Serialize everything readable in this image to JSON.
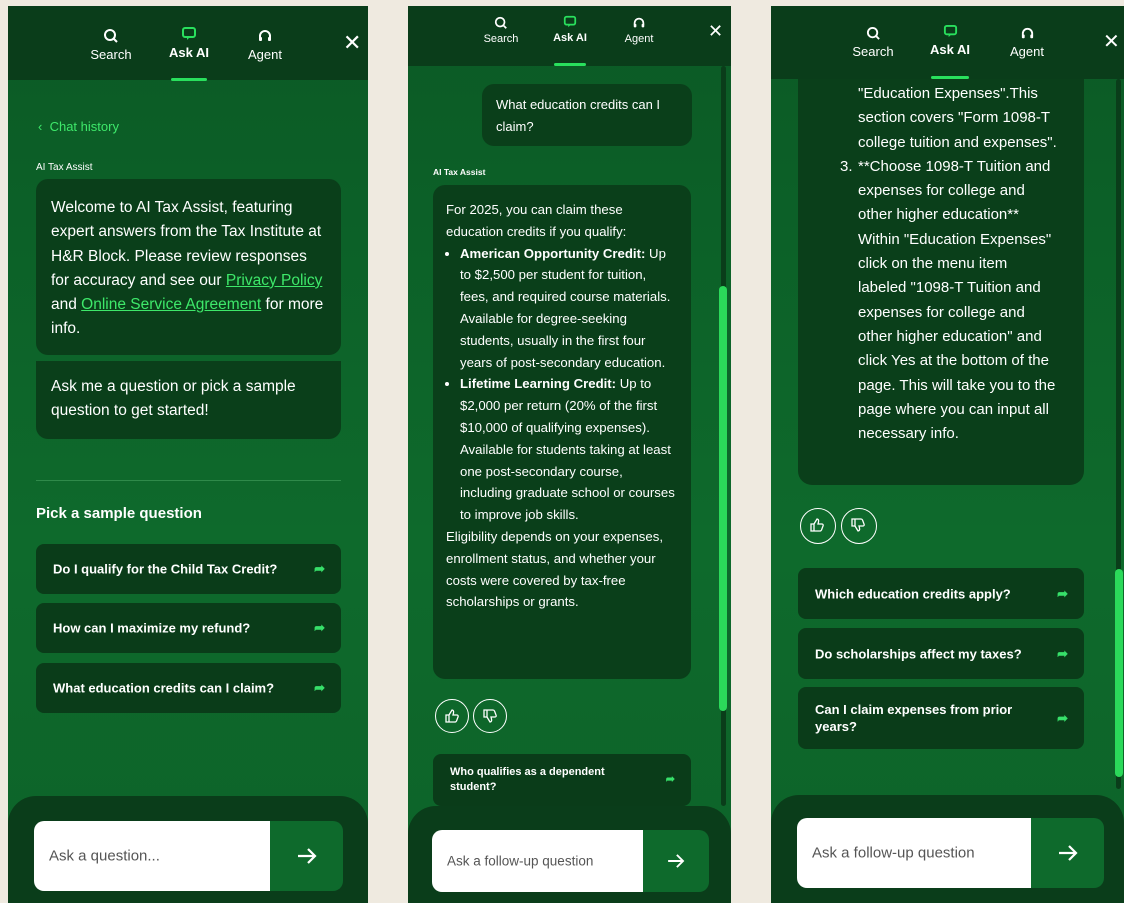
{
  "tabs": {
    "search": "Search",
    "ask_ai": "Ask AI",
    "agent": "Agent"
  },
  "panel1": {
    "chat_history": "Chat history",
    "assistant_label": "AI Tax Assist",
    "welcome_pre": "Welcome to AI Tax Assist, featuring expert answers from the Tax Institute at H&R Block. Please review responses for accuracy and see our ",
    "privacy_link": "Privacy Policy",
    "and": " and ",
    "online_link": "Online Service Agreement",
    "welcome_post": " for more info.",
    "prompt_msg": "Ask me a question or pick a sample question to get started!",
    "sample_heading": "Pick a sample question",
    "samples": [
      "Do I qualify for the Child Tax Credit?",
      "How can I maximize my refund?",
      "What education credits can I claim?"
    ],
    "input_placeholder": "Ask a question..."
  },
  "panel2": {
    "user_msg": "What education credits can I claim?",
    "assistant_label": "AI Tax Assist",
    "intro": "For 2025, you can claim these education credits if you qualify:",
    "credits": [
      {
        "name": "American Opportunity Credit:",
        "desc": "Up to $2,500 per student for tuition, fees, and required course materials. Available for degree-seeking students, usually in the first four years of post-secondary education."
      },
      {
        "name": "Lifetime Learning Credit:",
        "desc": "Up to $2,000 per return (20% of the first $10,000 of qualifying expenses). Available for students taking at least one post-secondary course, including graduate school or courses to improve job skills."
      }
    ],
    "eligibility": "Eligibility depends on your expenses, enrollment status, and whether your costs were covered by tax-free scholarships or grants.",
    "followup": "Who qualifies as a dependent student?",
    "input_placeholder": "Ask a follow-up question",
    "scroll_fraction": 0.5
  },
  "panel3": {
    "answer_lines": [
      "\"Education Expenses\".This",
      "section covers \"Form 1098-T",
      "college tuition and expenses\".",
      "**Choose 1098-T Tuition and",
      "expenses for college and",
      "other higher education**",
      "Within \"Education Expenses\"",
      "click on the menu item",
      "labeled \"1098-T Tuition and",
      "expenses for college and",
      "other higher education\" and",
      "click Yes at the bottom of the",
      "page. This will take you to the",
      "page where you can input all",
      "necessary info."
    ],
    "step_number": "3.",
    "followups": [
      "Which education credits apply?",
      "Do scholarships affect my taxes?",
      "Can I claim expenses from prior years?"
    ],
    "input_placeholder": "Ask a follow-up question",
    "scroll_fraction": 0.9
  },
  "colors": {
    "accent": "#29e05d",
    "panel_bg": "#0e6a2c",
    "bubble_bg": "#0a3f1a",
    "page_bg": "#efeae0"
  }
}
